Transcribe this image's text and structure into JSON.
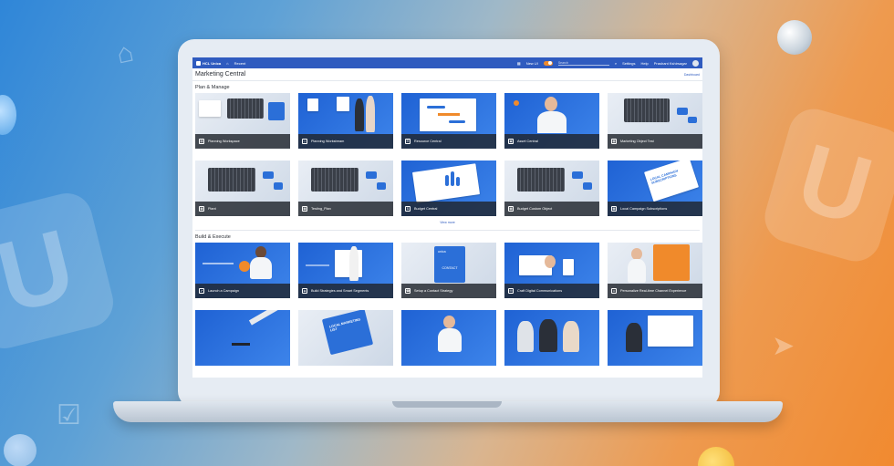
{
  "app": {
    "brand": "HCL Unica",
    "nav_item": "Recent",
    "toggle_label": "New UI",
    "search_placeholder": "Search",
    "settings_label": "Settings",
    "help_label": "Help",
    "user_name": "Prashant Kshirsagar"
  },
  "page": {
    "title": "Marketing Central",
    "dashboard_link": "Dashboard"
  },
  "sections": {
    "plan_manage": {
      "title": "Plan & Manage",
      "tiles": [
        {
          "label": "Planning Workspace",
          "icon": "workspace-icon"
        },
        {
          "label": "Planning Workstream",
          "icon": "workstream-icon"
        },
        {
          "label": "Resource Central",
          "icon": "resource-icon"
        },
        {
          "label": "Asset Central",
          "icon": "asset-icon"
        },
        {
          "label": "Marketing Object Test",
          "icon": "grid-icon"
        },
        {
          "label": "Plant",
          "icon": "grid-icon"
        },
        {
          "label": "Testing_Plan",
          "icon": "grid-icon"
        },
        {
          "label": "Budget Central",
          "icon": "budget-icon"
        },
        {
          "label": "Budget Custom Object",
          "icon": "grid-icon"
        },
        {
          "label": "Local Campaign Subscriptions",
          "icon": "grid-icon"
        }
      ],
      "view_more": "View more"
    },
    "build_execute": {
      "title": "Build & Execute",
      "tiles": [
        {
          "label": "Launch a Campaign",
          "icon": "launch-icon"
        },
        {
          "label": "Build Strategies and Smart Segments",
          "icon": "segments-icon"
        },
        {
          "label": "Setup a Contact Strategy",
          "icon": "contact-icon"
        },
        {
          "label": "Craft Digital Communications",
          "icon": "communications-icon"
        },
        {
          "label": "Personalize Real-time Channel Experience",
          "icon": "personalize-icon"
        }
      ]
    }
  },
  "tile_art_text": {
    "contact_card": "CONTACT",
    "unica_badge": "unica",
    "local_campaign_sign": "LOCAL CAMPAIGN SUBSCRIPTIONS",
    "local_marketing_sign": "LOCAL MARKETING LIST"
  },
  "colors": {
    "header_blue": "#2f5bbf",
    "tile_blue": "#2b6fd8",
    "accent_orange": "#f08a2b"
  }
}
